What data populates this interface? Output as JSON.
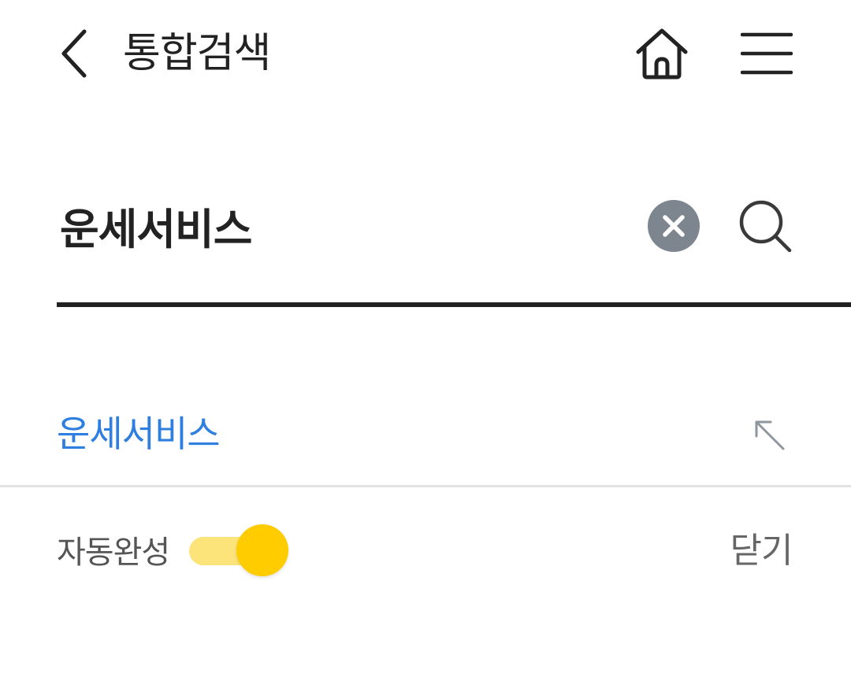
{
  "header": {
    "title": "통합검색",
    "back_icon": "chevron-left-icon",
    "home_icon": "home-icon",
    "menu_icon": "hamburger-menu-icon"
  },
  "search": {
    "value": "운세서비스",
    "clear_icon": "clear-circle-icon",
    "search_icon": "search-icon"
  },
  "suggestions": [
    {
      "text": "운세서비스",
      "action_icon": "arrow-up-left-icon"
    }
  ],
  "autocomplete": {
    "label": "자동완성",
    "enabled": true,
    "close_label": "닫기"
  },
  "colors": {
    "text_primary": "#222222",
    "suggestion": "#2f7fe0",
    "toggle_knob": "#ffcc00",
    "toggle_track": "#fde47a",
    "clear_bg": "#7d858e",
    "divider": "#e3e3e3"
  }
}
